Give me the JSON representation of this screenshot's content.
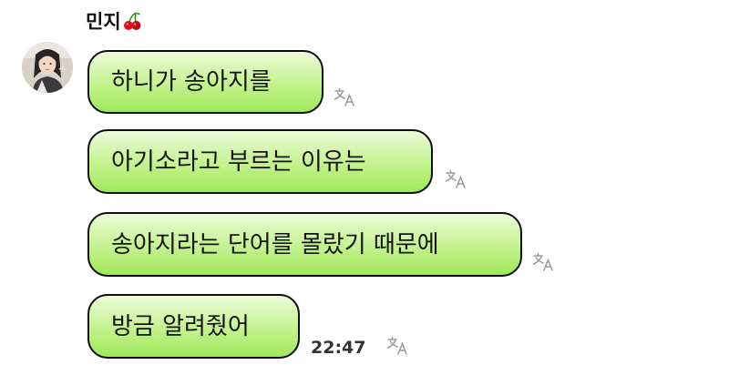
{
  "chat": {
    "sender_name": "민지",
    "sender_emoji": "cherry-icon",
    "messages": [
      {
        "text": "하니가 송아지를",
        "icon": "translate-icon"
      },
      {
        "text": "아기소라고 부르는 이유는",
        "icon": "translate-icon"
      },
      {
        "text": "송아지라는 단어를 몰랐기 때문에",
        "icon": "translate-icon"
      },
      {
        "text": "방금 알려줬어",
        "icon": "translate-icon"
      }
    ],
    "timestamp": "22:47"
  },
  "colors": {
    "bubble_top": "#ebfbd9",
    "bubble_bottom": "#9fe85a",
    "bubble_border": "#0d0d0d",
    "icon": "#9a9a9a",
    "cherry": "#d5101c",
    "background": "#ffffff"
  }
}
